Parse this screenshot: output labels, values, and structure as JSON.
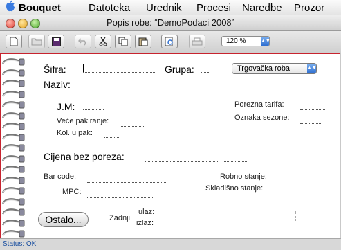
{
  "menubar": {
    "app": "Bouquet",
    "items": [
      "Datoteka",
      "Urednik",
      "Procesi",
      "Naredbe",
      "Prozor"
    ]
  },
  "window": {
    "title": "Popis robe: “DemoPodaci 2008”"
  },
  "toolbar": {
    "buttons": [
      "new-document-icon",
      "open-folder-icon",
      "save-icon",
      "undo-icon",
      "cut-icon",
      "copy-icon",
      "paste-icon",
      "search-icon",
      "print-icon"
    ],
    "zoom": "120 %"
  },
  "form": {
    "sifra_label": "Šifra:",
    "grupa_label": "Grupa:",
    "grupa_value": "Trgovačka roba",
    "naziv_label": "Naziv:",
    "jm_label": "J.M:",
    "porezna_tarifa_label": "Porezna tarifa:",
    "vece_pakiranje_label": "Veće pakiranje:",
    "oznaka_sezone_label": "Oznaka sezone:",
    "kol_u_pak_label": "Kol. u pak:",
    "cijena_label": "Cijena bez poreza:",
    "bar_code_label": "Bar code:",
    "robno_stanje_label": "Robno stanje:",
    "skladisno_stanje_label": "Skladišno stanje:",
    "mpc_label": "MPC:",
    "ostalo_button": "Ostalo...",
    "zadnji_label": "Zadnji",
    "ulaz_label": "ulaz:",
    "izlaz_label": "izlaz:"
  },
  "status": {
    "text": "Status: OK"
  },
  "colors": {
    "accent": "#2f6fd0",
    "document_border": "#c7232e",
    "status_text": "#1a4fa0"
  }
}
